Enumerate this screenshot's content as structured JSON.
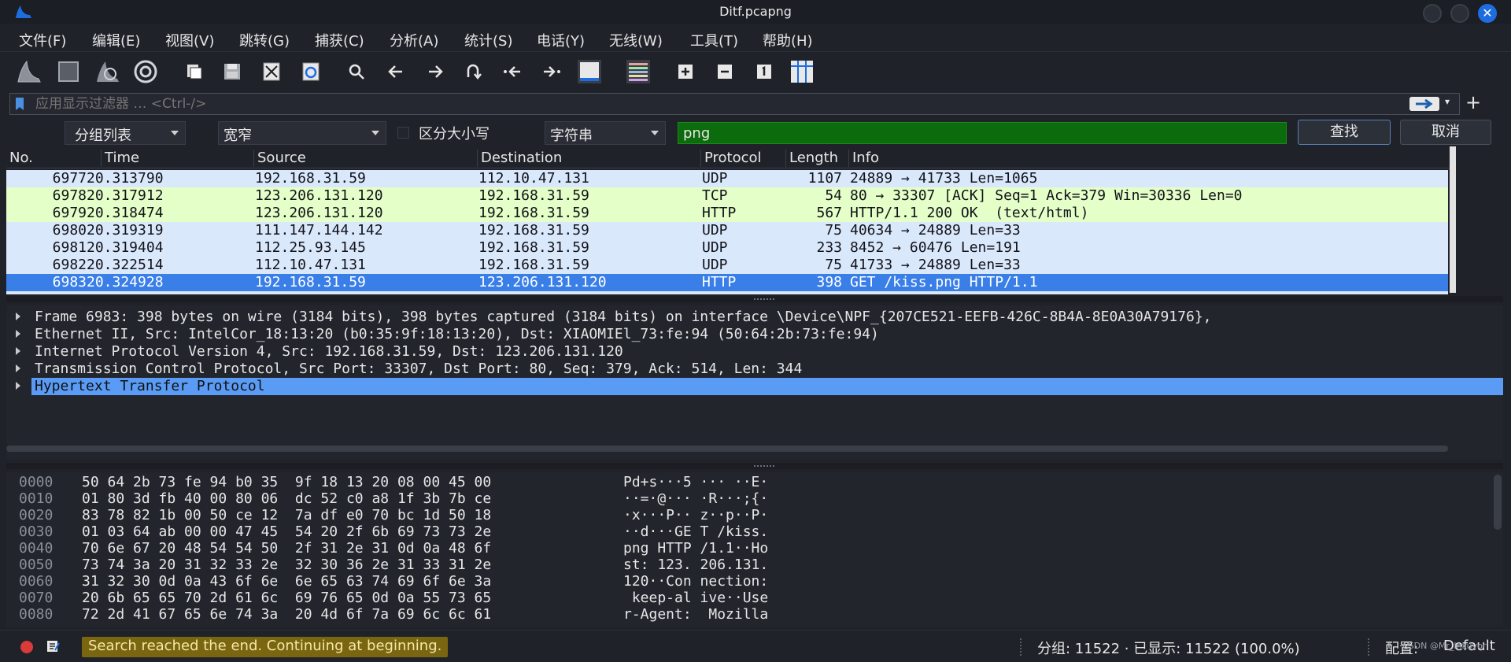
{
  "window": {
    "title": "Ditf.pcapng",
    "close_glyph": "✕"
  },
  "menu": [
    "文件(F)",
    "编辑(E)",
    "视图(V)",
    "跳转(G)",
    "捕获(C)",
    "分析(A)",
    "统计(S)",
    "电话(Y)",
    "无线(W)",
    "工具(T)",
    "帮助(H)"
  ],
  "toolbar": {
    "icons": [
      "start-capture-icon",
      "stop-capture-icon",
      "restart-capture-icon",
      "capture-options-icon",
      "open-file-icon",
      "save-file-icon",
      "close-file-icon",
      "reload-file-icon",
      "find-packet-icon",
      "go-back-icon",
      "go-forward-icon",
      "go-to-packet-icon",
      "go-first-packet-icon",
      "go-last-packet-icon",
      "auto-scroll-icon",
      "colorize-icon",
      "zoom-in-icon",
      "zoom-out-icon",
      "normal-size-icon",
      "resize-columns-icon"
    ]
  },
  "display_filter": {
    "placeholder": "应用显示过滤器 … <Ctrl-/>",
    "add_glyph": "+"
  },
  "find_bar": {
    "search_in": "分组列表",
    "char_width": "宽窄",
    "case_sensitive_label": "区分大小写",
    "search_type": "字符串",
    "search_text": "png",
    "find_button": "查找",
    "cancel_button": "取消"
  },
  "packet_list": {
    "columns": [
      "No.",
      "Time",
      "Source",
      "Destination",
      "Protocol",
      "Length",
      "Info"
    ],
    "rows": [
      {
        "no": "6977",
        "time": "20.313790",
        "src": "192.168.31.59",
        "dst": "112.10.47.131",
        "proto": "UDP",
        "len": "1107",
        "info": "24889 → 41733 Len=1065",
        "bg": "#dae8fc",
        "fg": "#12131a"
      },
      {
        "no": "6978",
        "time": "20.317912",
        "src": "123.206.131.120",
        "dst": "192.168.31.59",
        "proto": "TCP",
        "len": "54",
        "info": "80 → 33307 [ACK] Seq=1 Ack=379 Win=30336 Len=0",
        "bg": "#e4ffc7",
        "fg": "#12131a"
      },
      {
        "no": "6979",
        "time": "20.318474",
        "src": "123.206.131.120",
        "dst": "192.168.31.59",
        "proto": "HTTP",
        "len": "567",
        "info": "HTTP/1.1 200 OK  (text/html)",
        "bg": "#e4ffc7",
        "fg": "#12131a"
      },
      {
        "no": "6980",
        "time": "20.319319",
        "src": "111.147.144.142",
        "dst": "192.168.31.59",
        "proto": "UDP",
        "len": "75",
        "info": "40634 → 24889 Len=33",
        "bg": "#dae8fc",
        "fg": "#12131a"
      },
      {
        "no": "6981",
        "time": "20.319404",
        "src": "112.25.93.145",
        "dst": "192.168.31.59",
        "proto": "UDP",
        "len": "233",
        "info": "8452 → 60476 Len=191",
        "bg": "#dae8fc",
        "fg": "#12131a"
      },
      {
        "no": "6982",
        "time": "20.322514",
        "src": "112.10.47.131",
        "dst": "192.168.31.59",
        "proto": "UDP",
        "len": "75",
        "info": "41733 → 24889 Len=33",
        "bg": "#dae8fc",
        "fg": "#12131a"
      },
      {
        "no": "6983",
        "time": "20.324928",
        "src": "192.168.31.59",
        "dst": "123.206.131.120",
        "proto": "HTTP",
        "len": "398",
        "info": "GET /kiss.png HTTP/1.1",
        "bg": "#3a7fe8",
        "fg": "#ffffff"
      }
    ]
  },
  "details": [
    "Frame 6983: 398 bytes on wire (3184 bits), 398 bytes captured (3184 bits) on interface \\Device\\NPF_{207CE521-EEFB-426C-8B4A-8E0A30A79176},",
    "Ethernet II, Src: IntelCor_18:13:20 (b0:35:9f:18:13:20), Dst: XIAOMIEl_73:fe:94 (50:64:2b:73:fe:94)",
    "Internet Protocol Version 4, Src: 192.168.31.59, Dst: 123.206.131.120",
    "Transmission Control Protocol, Src Port: 33307, Dst Port: 80, Seq: 379, Ack: 514, Len: 344",
    "Hypertext Transfer Protocol"
  ],
  "bytes": [
    {
      "offset": "0000",
      "hex": "50 64 2b 73 fe 94 b0 35  9f 18 13 20 08 00 45 00",
      "ascii": "Pd+s···5 ··· ··E·"
    },
    {
      "offset": "0010",
      "hex": "01 80 3d fb 40 00 80 06  dc 52 c0 a8 1f 3b 7b ce",
      "ascii": "··=·@··· ·R···;{·"
    },
    {
      "offset": "0020",
      "hex": "83 78 82 1b 00 50 ce 12  7a df e0 70 bc 1d 50 18",
      "ascii": "·x···P·· z··p··P·"
    },
    {
      "offset": "0030",
      "hex": "01 03 64 ab 00 00 47 45  54 20 2f 6b 69 73 73 2e",
      "ascii": "··d···GE T /kiss."
    },
    {
      "offset": "0040",
      "hex": "70 6e 67 20 48 54 54 50  2f 31 2e 31 0d 0a 48 6f",
      "ascii": "png HTTP /1.1··Ho"
    },
    {
      "offset": "0050",
      "hex": "73 74 3a 20 31 32 33 2e  32 30 36 2e 31 33 31 2e",
      "ascii": "st: 123. 206.131."
    },
    {
      "offset": "0060",
      "hex": "31 32 30 0d 0a 43 6f 6e  6e 65 63 74 69 6f 6e 3a",
      "ascii": "120··Con nection:"
    },
    {
      "offset": "0070",
      "hex": "20 6b 65 65 70 2d 61 6c  69 76 65 0d 0a 55 73 65",
      "ascii": " keep-al ive··Use"
    },
    {
      "offset": "0080",
      "hex": "72 2d 41 67 65 6e 74 3a  20 4d 6f 7a 69 6c 6c 61",
      "ascii": "r-Agent:  Mozilla"
    }
  ],
  "status": {
    "message": "Search reached the end. Continuing at beginning.",
    "count": "分组: 11522 · 已显示: 11522 (100.0%)",
    "profile_label": "配置:",
    "profile": "Default",
    "watermark": "CSDN @Mr_Inkuyor"
  },
  "colors": {
    "selected_row": "#3a7fe8",
    "udp_row": "#dae8fc",
    "tcp_row": "#e4ffc7",
    "find_input_bg": "#0c6b0c",
    "status_msg_bg": "#7a6610"
  }
}
